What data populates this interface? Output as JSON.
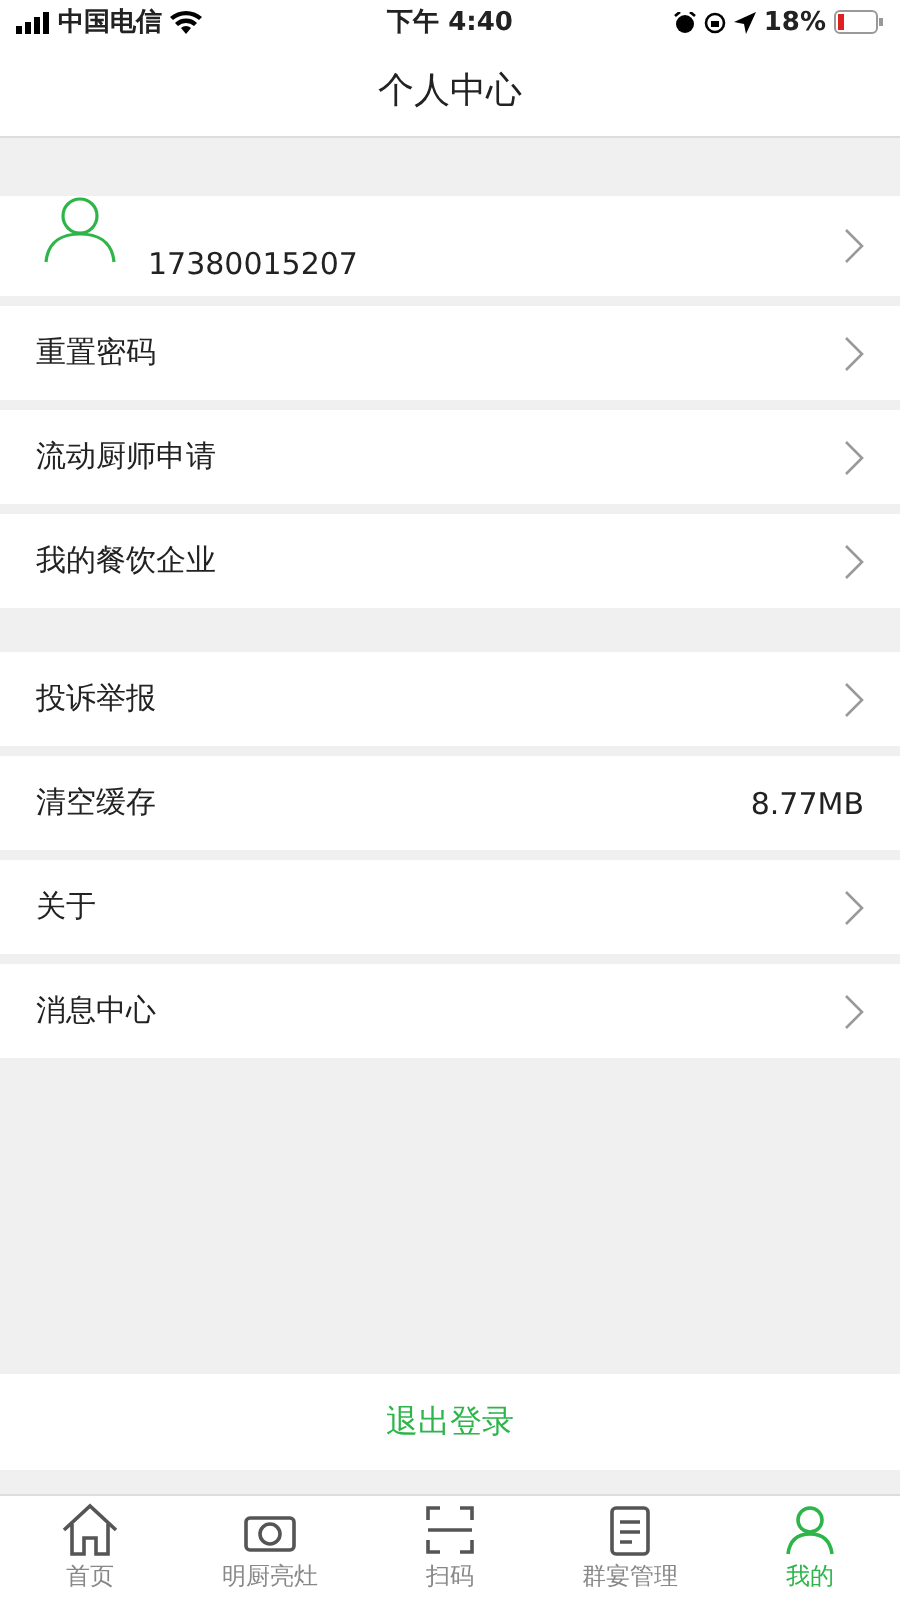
{
  "status_bar": {
    "carrier": "中国电信",
    "time": "下午 4:40",
    "battery": "18%"
  },
  "header": {
    "title": "个人中心"
  },
  "profile": {
    "phone": "17380015207"
  },
  "groups": [
    {
      "items": [
        {
          "kind": "link",
          "label": "重置密码"
        },
        {
          "kind": "link",
          "label": "流动厨师申请"
        },
        {
          "kind": "link",
          "label": "我的餐饮企业"
        }
      ]
    },
    {
      "items": [
        {
          "kind": "link",
          "label": "投诉举报"
        },
        {
          "kind": "value",
          "label": "清空缓存",
          "value": "8.77MB"
        },
        {
          "kind": "link",
          "label": "关于"
        },
        {
          "kind": "link",
          "label": "消息中心"
        }
      ]
    }
  ],
  "logout": "退出登录",
  "tabs": [
    {
      "label": "首页",
      "selected": false
    },
    {
      "label": "明厨亮灶",
      "selected": false
    },
    {
      "label": "扫码",
      "selected": false
    },
    {
      "label": "群宴管理",
      "selected": false
    },
    {
      "label": "我的",
      "selected": true
    }
  ]
}
